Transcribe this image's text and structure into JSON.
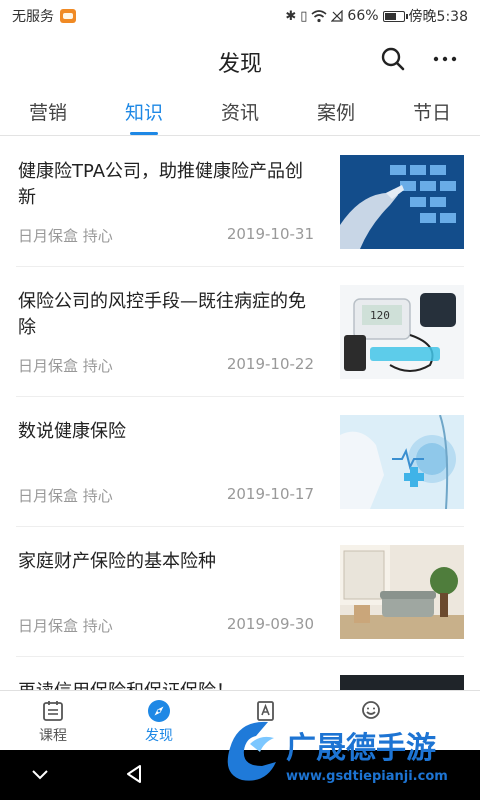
{
  "status_bar": {
    "carrier": "无服务",
    "battery_percent": "66%",
    "battery_level": 0.66,
    "time": "傍晚5:38"
  },
  "header": {
    "title": "发现"
  },
  "tabs": [
    {
      "label": "营销",
      "active": false
    },
    {
      "label": "知识",
      "active": true
    },
    {
      "label": "资讯",
      "active": false
    },
    {
      "label": "案例",
      "active": false
    },
    {
      "label": "节日",
      "active": false
    }
  ],
  "articles": [
    {
      "title": "健康险TPA公司，助推健康险产品创新",
      "source": "日月保盒 持心",
      "date": "2019-10-31",
      "thumb_icon": "digital-touch-image"
    },
    {
      "title": "保险公司的风控手段—既往病症的免除",
      "source": "日月保盒 持心",
      "date": "2019-10-22",
      "thumb_icon": "blood-pressure-monitor-image"
    },
    {
      "title": "数说健康保险",
      "source": "日月保盒 持心",
      "date": "2019-10-17",
      "thumb_icon": "medical-tech-image"
    },
    {
      "title": "家庭财产保险的基本险种",
      "source": "日月保盒 持心",
      "date": "2019-09-30",
      "thumb_icon": "living-room-image"
    },
    {
      "title": "再读信用保险和保证保险！",
      "source": "",
      "date": "",
      "thumb_icon": "dark-photo-image"
    }
  ],
  "bottom_nav": [
    {
      "label": "课程",
      "icon": "calendar-icon",
      "active": false
    },
    {
      "label": "发现",
      "icon": "compass-icon",
      "active": true
    },
    {
      "label": "",
      "icon": "document-icon",
      "active": false
    },
    {
      "label": "",
      "icon": "user-icon",
      "active": false
    }
  ],
  "watermark": {
    "brand": "广晟德手游",
    "url": "www.gsdtiepianji.com"
  },
  "colors": {
    "accent": "#1e88e5",
    "text": "#222222",
    "muted": "#999999"
  }
}
